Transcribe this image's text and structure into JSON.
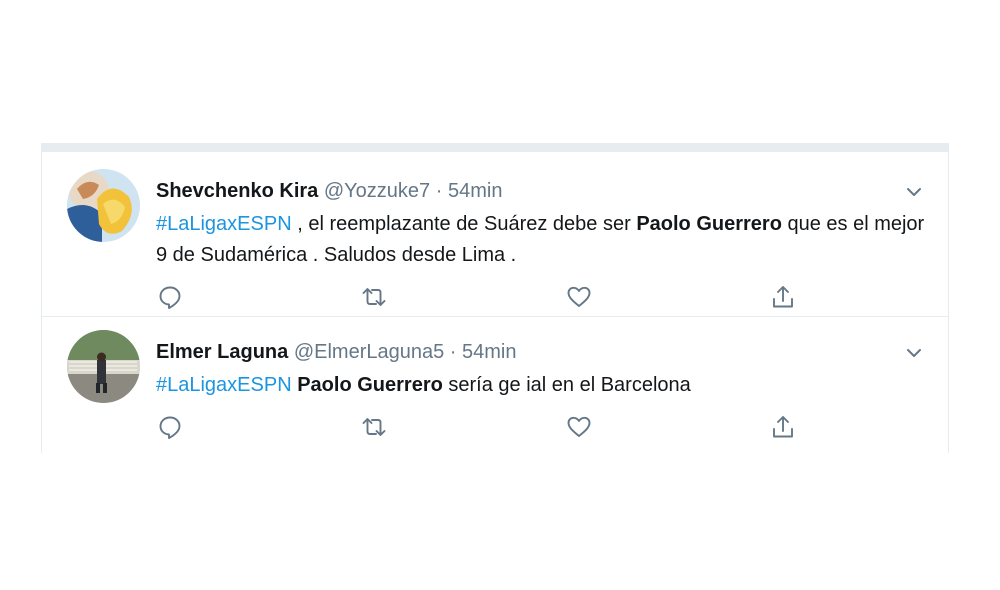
{
  "tweets": [
    {
      "name": "Shevchenko Kira",
      "handle": "@Yozzuke7",
      "separator": "·",
      "time": "54min",
      "text": {
        "hashtag": "#LaLigaxESPN",
        "part1": " , el reemplazante de Suárez debe ser ",
        "bold": "Paolo Guerrero",
        "part2": " que es el mejor 9 de Sudamérica . Saludos desde Lima ."
      }
    },
    {
      "name": "Elmer Laguna",
      "handle": "@ElmerLaguna5",
      "separator": "·",
      "time": "54min",
      "text": {
        "hashtag": "#LaLigaxESPN",
        "part1": " ",
        "bold": "Paolo Guerrero",
        "part2": " sería ge ial en el Barcelona"
      }
    }
  ],
  "icons": {
    "reply": "reply-icon",
    "retweet": "retweet-icon",
    "like": "heart-icon",
    "share": "share-icon",
    "more": "chevron-down-icon"
  },
  "colors": {
    "hashtag": "#1b95e0",
    "secondary_text": "#657786",
    "divider": "#e6ecf0"
  }
}
